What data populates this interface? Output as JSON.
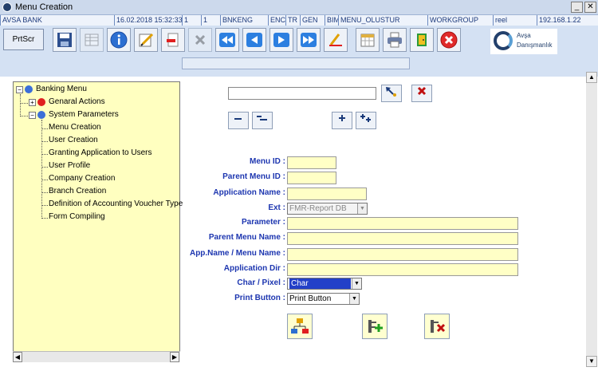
{
  "window": {
    "title": "Menu Creation",
    "minimize": "_",
    "close": "✕"
  },
  "status_bar": [
    "AVSA BANK",
    "16.02.2018 15:32:33",
    "1",
    "1",
    "BNKENG",
    "ENC",
    "TR",
    "GEN",
    "BIM",
    "MENU_OLUSTUR",
    "WORKGROUP",
    "reel",
    "192.168.1.22"
  ],
  "toolbar": {
    "prtscr_label": "PrtScr",
    "tools": [
      "save-icon",
      "grid-icon",
      "info-icon",
      "edit-icon",
      "remove-icon",
      "delete-icon",
      "first-icon",
      "previous-icon",
      "next-icon",
      "last-icon",
      "clear-icon",
      "calendar-icon",
      "print-icon",
      "exit-door-icon",
      "cancel-icon"
    ],
    "logo": {
      "line1": "Avşa",
      "line2": "Danışmanlık"
    }
  },
  "tree": {
    "root": "Banking Menu",
    "groups": [
      {
        "label": "Genaral Actions",
        "collapsed": true,
        "color": "#e02020"
      },
      {
        "label": "System Parameters",
        "collapsed": false,
        "color": "#3c6fd8"
      }
    ],
    "items": [
      "Menu Creation",
      "User Creation",
      "Granting Application to Users",
      "User Profile",
      "Company Creation",
      "Branch Creation",
      "Definition of Accounting Voucher Type",
      "Form Compiling"
    ]
  },
  "form": {
    "search_value": "",
    "labels": {
      "menu_id": "Menu ID :",
      "parent_menu_id": "Parent Menu ID :",
      "application_name": "Application Name :",
      "ext": "Ext :",
      "parameter": "Parameter :",
      "parent_menu_name": "Parent Menu Name :",
      "app_menu_name": "App.Name / Menu Name :",
      "application_dir": "Application Dir :",
      "char_pixel": "Char / Pixel :",
      "print_button": "Print Button :"
    },
    "ext_value": "FMR-Report DB",
    "char_pixel_value": "Char",
    "print_button_value": "Print Button"
  },
  "colors": {
    "field_bg": "#ffffc6",
    "label_blue": "#1d36b0",
    "toolbar_bg": "#d4e1f3",
    "tree_bg": "#ffffc0"
  }
}
